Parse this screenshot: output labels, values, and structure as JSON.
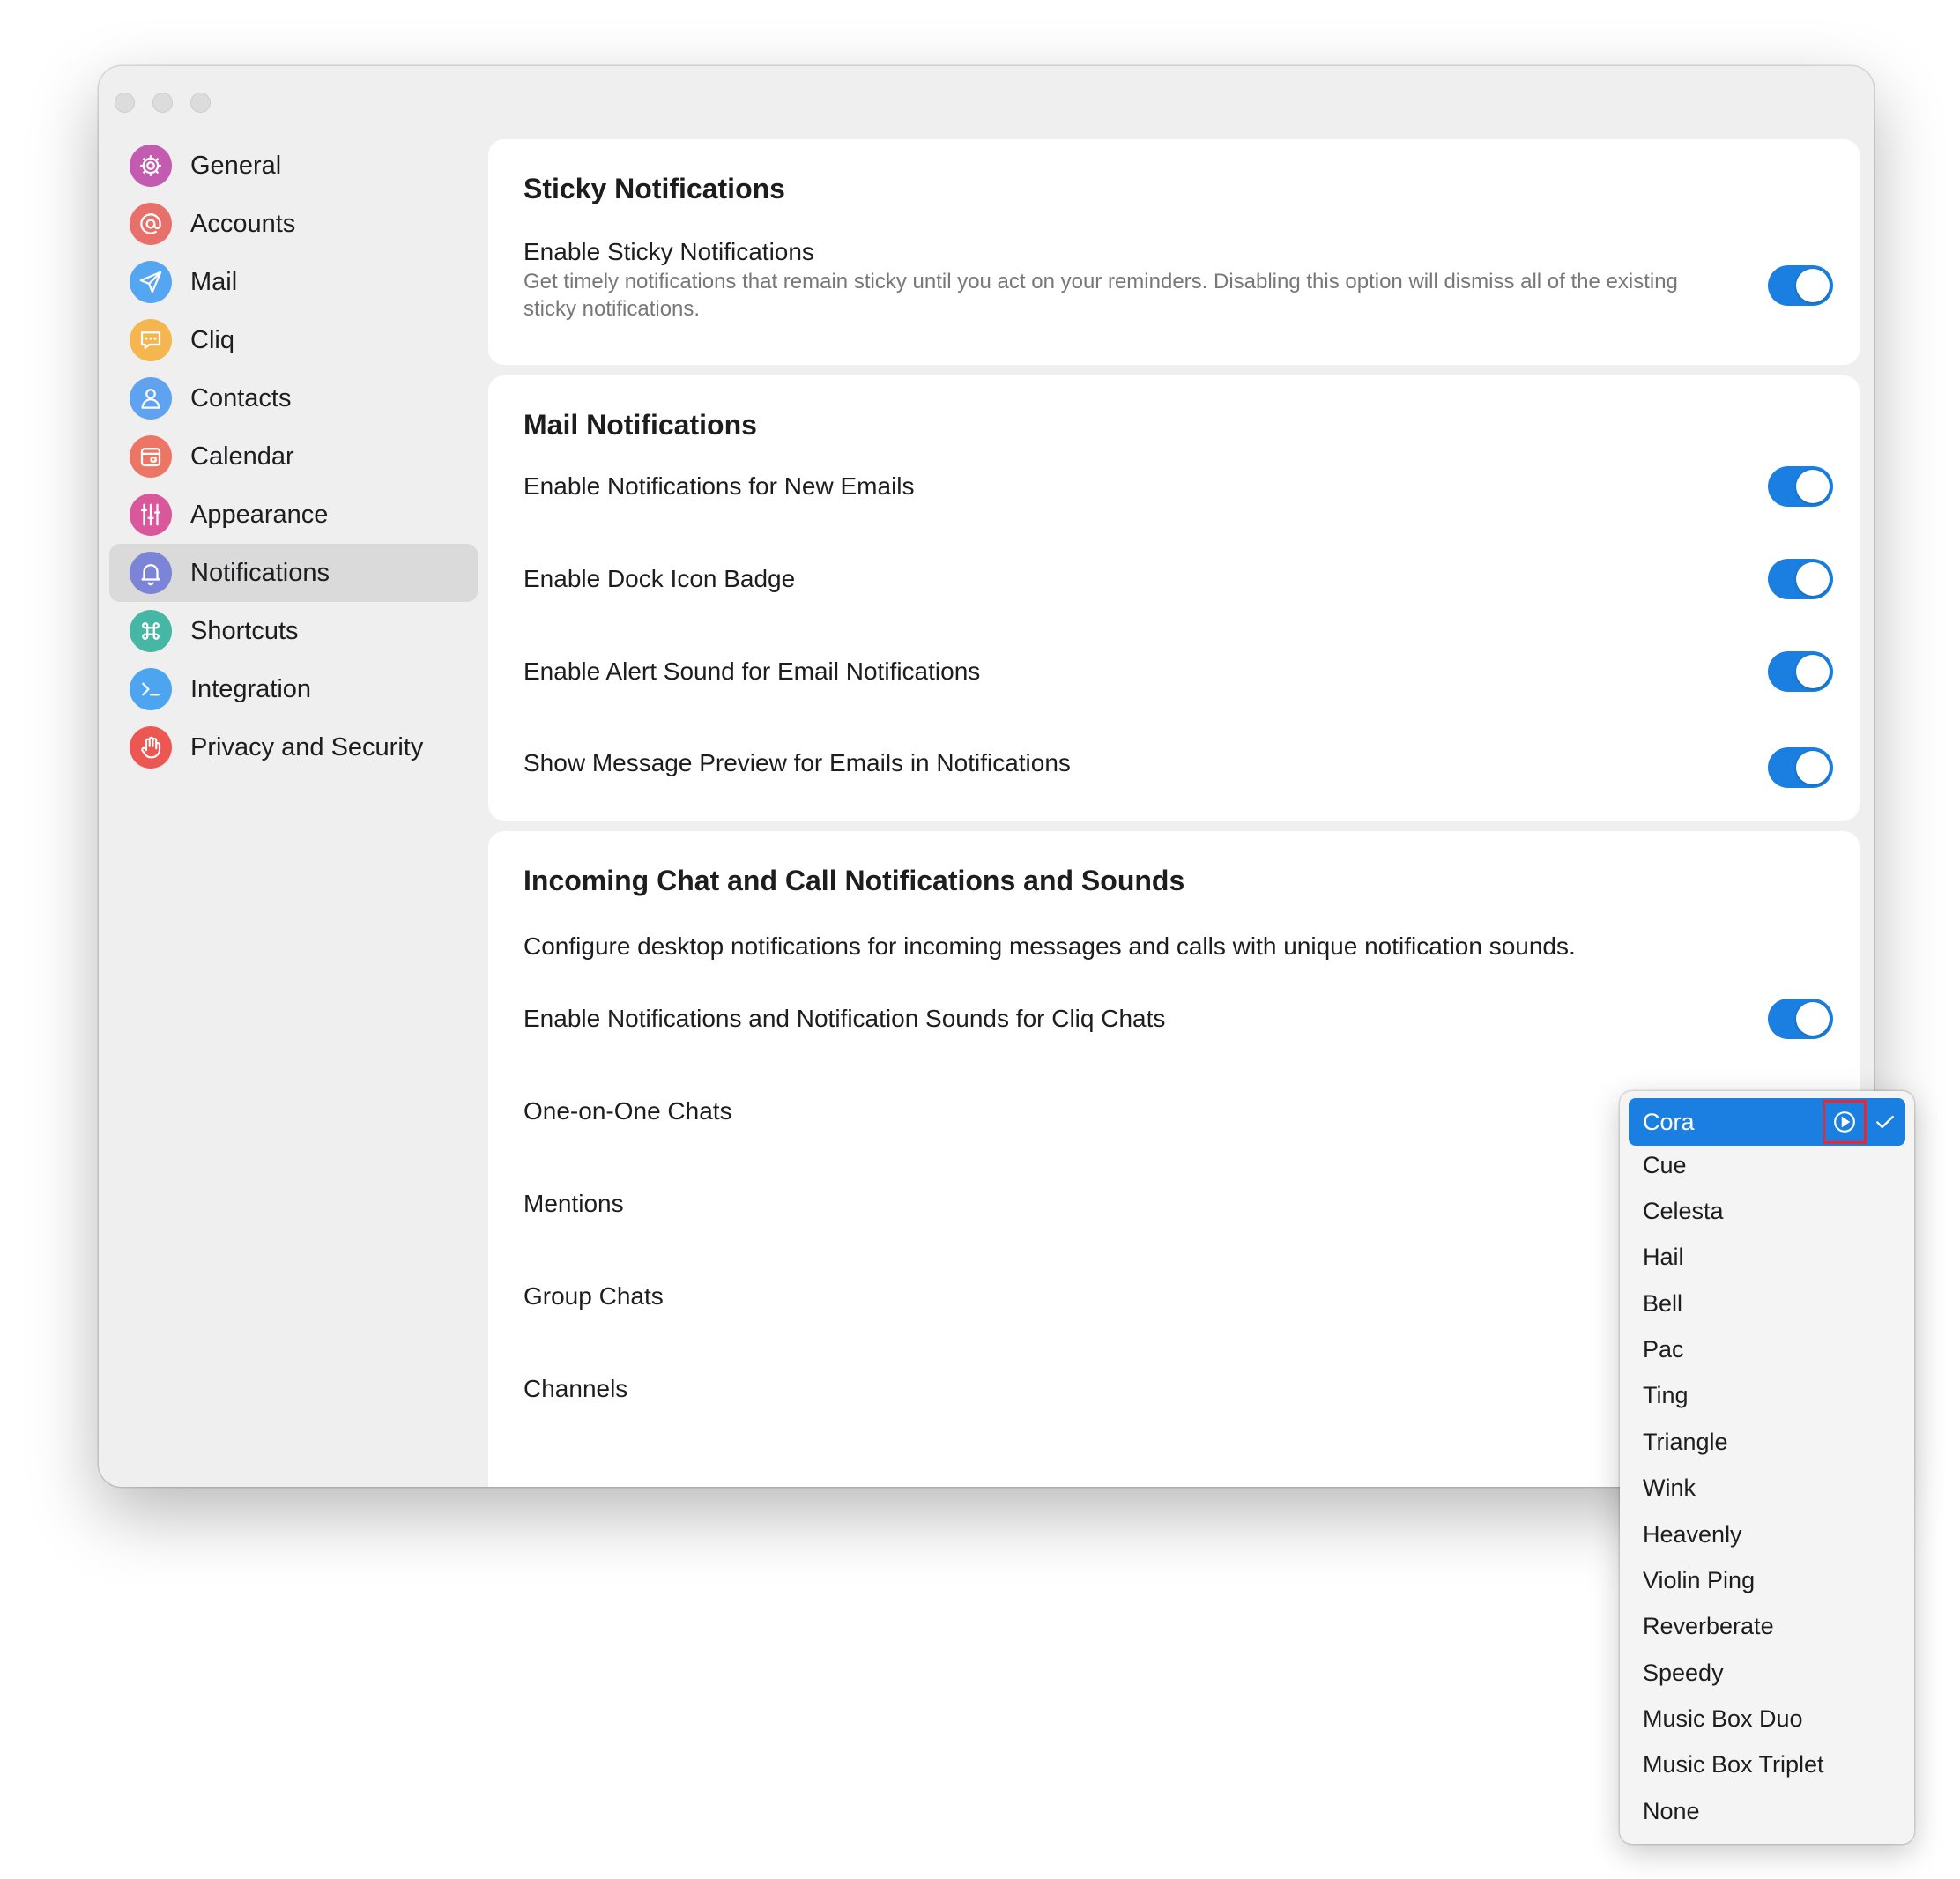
{
  "sidebar": {
    "items": [
      {
        "label": "General",
        "icon": "gear-icon",
        "color": "#c35cb1"
      },
      {
        "label": "Accounts",
        "icon": "at-icon",
        "color": "#e8706a"
      },
      {
        "label": "Mail",
        "icon": "paper-plane-icon",
        "color": "#55a6f0"
      },
      {
        "label": "Cliq",
        "icon": "chat-bubble-icon",
        "color": "#f5b54f"
      },
      {
        "label": "Contacts",
        "icon": "person-icon",
        "color": "#5fa2ef"
      },
      {
        "label": "Calendar",
        "icon": "calendar-icon",
        "color": "#ec7566"
      },
      {
        "label": "Appearance",
        "icon": "sliders-icon",
        "color": "#d9579b"
      },
      {
        "label": "Notifications",
        "icon": "bell-icon",
        "color": "#7b84d6"
      },
      {
        "label": "Shortcuts",
        "icon": "command-icon",
        "color": "#46b7a4"
      },
      {
        "label": "Integration",
        "icon": "terminal-icon",
        "color": "#4ea5ef"
      },
      {
        "label": "Privacy and Security",
        "icon": "hand-icon",
        "color": "#ec5752"
      }
    ],
    "active": "Notifications"
  },
  "sticky": {
    "title": "Sticky Notifications",
    "enable_label": "Enable Sticky Notifications",
    "enable_desc": "Get timely notifications that remain sticky until you act on your reminders. Disabling this option will dismiss all of the existing sticky notifications.",
    "enabled": true
  },
  "mail": {
    "title": "Mail Notifications",
    "rows": [
      {
        "label": "Enable Notifications for New Emails",
        "enabled": true
      },
      {
        "label": "Enable Dock Icon Badge",
        "enabled": true
      },
      {
        "label": "Enable Alert Sound for Email Notifications",
        "enabled": true
      },
      {
        "label": "Show Message Preview for Emails in Notifications",
        "enabled": true
      }
    ]
  },
  "chat": {
    "title": "Incoming Chat and Call Notifications and Sounds",
    "desc": "Configure desktop notifications for incoming messages and calls with unique notification sounds.",
    "enable_label": "Enable Notifications and Notification Sounds for Cliq Chats",
    "enabled": true,
    "rows": [
      "One-on-One Chats",
      "Mentions",
      "Group Chats",
      "Channels"
    ]
  },
  "sound_menu": {
    "selected": "Cora",
    "options": [
      "Cue",
      "Celesta",
      "Hail",
      "Bell",
      "Pac",
      "Ting",
      "Triangle",
      "Wink",
      "Heavenly",
      "Violin Ping",
      "Reverberate",
      "Speedy",
      "Music Box Duo",
      "Music Box Triplet",
      "None"
    ]
  },
  "colors": {
    "accent": "#1a7fe0",
    "highlight_box": "#e8282e"
  }
}
